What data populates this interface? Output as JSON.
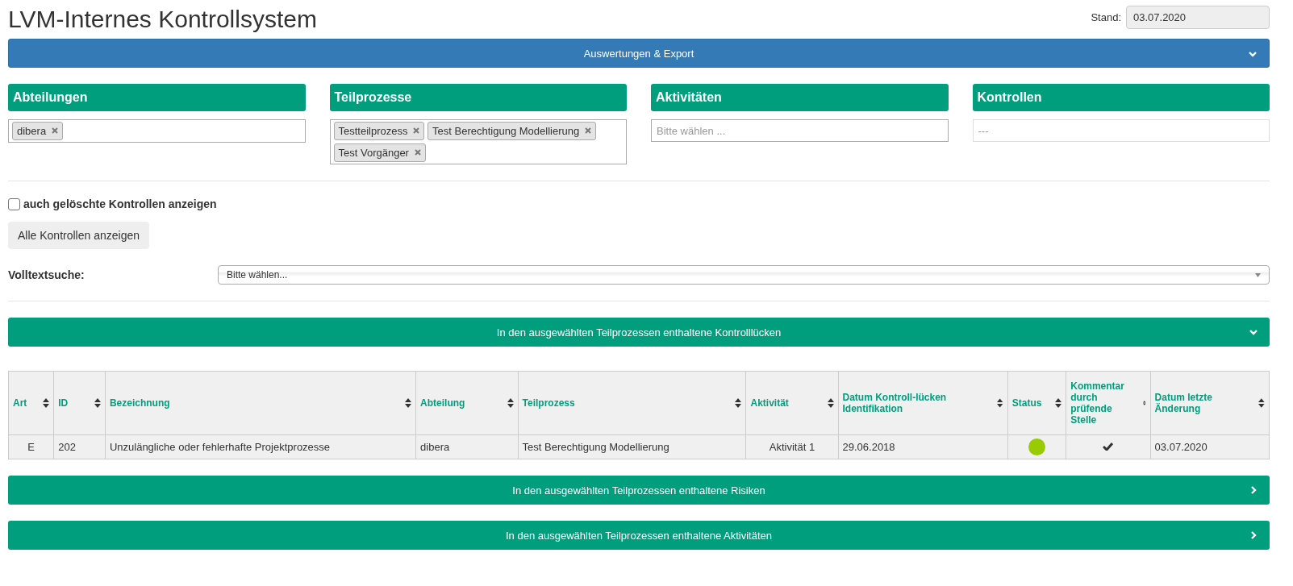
{
  "header": {
    "title": "LVM-Internes Kontrollsystem",
    "stand_label": "Stand:",
    "stand_value": "03.07.2020"
  },
  "export_bar": {
    "label": "Auswertungen & Export",
    "expanded": true
  },
  "filters": [
    {
      "title": "Abteilungen",
      "tags": [
        "dibera"
      ],
      "disabled": false
    },
    {
      "title": "Teilprozesse",
      "tags": [
        "Testteilprozess",
        "Test Berechtigung Modellierung",
        "Test Vorgänger"
      ],
      "disabled": false
    },
    {
      "title": "Aktivitäten",
      "placeholder": "Bitte wählen ...",
      "disabled": false
    },
    {
      "title": "Kontrollen",
      "placeholder": "---",
      "disabled": true
    }
  ],
  "show_deleted": {
    "label": "auch gelöschte Kontrollen anzeigen",
    "checked": false
  },
  "show_all_button": "Alle Kontrollen anzeigen",
  "fulltext": {
    "label": "Volltextsuche:",
    "placeholder": "Bitte wählen..."
  },
  "sections": [
    {
      "label": "In den ausgewählten Teilprozessen enthaltene Kontrolllücken",
      "expanded": true,
      "table": {
        "columns": [
          "Art",
          "ID",
          "Bezeichnung",
          "Abteilung",
          "Teilprozess",
          "Aktivität",
          "Datum Kontroll-lücken Identifikation",
          "Status",
          "Kommentar durch prüfende Stelle",
          "Datum letzte Änderung"
        ],
        "rows": [
          {
            "art": "E",
            "id": "202",
            "bezeichnung": "Unzulängliche oder fehlerhafte Projektprozesse",
            "abteilung": "dibera",
            "teilprozess": "Test Berechtigung Modellierung",
            "aktivitaet": "Aktivität 1",
            "datum": "29.06.2018",
            "color": "#99cc00",
            "commented": true,
            "geaendert": "03.07.2020"
          }
        ]
      }
    },
    {
      "label": "In den ausgewählten Teilprozessen enthaltene Risiken",
      "expanded": false
    },
    {
      "label": "In den ausgewählten Teilprozessen enthaltene Aktivitäten",
      "expanded": false
    }
  ]
}
